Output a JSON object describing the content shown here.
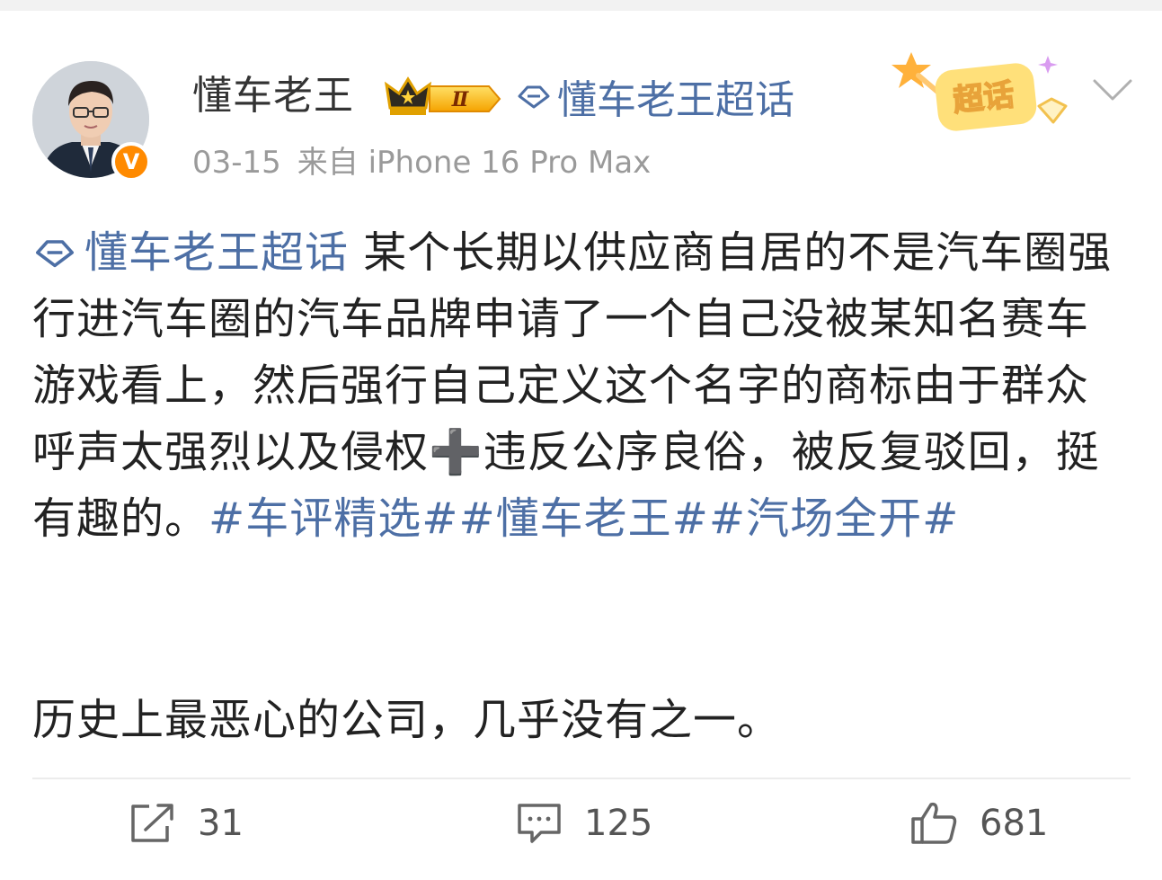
{
  "post": {
    "author": {
      "name": "懂车老王",
      "verified_badge": "V",
      "level_badge": "Ⅱ",
      "topic_tag": "懂车老王超话"
    },
    "meta": {
      "date": "03-15",
      "source": "来自 iPhone 16 Pro Max"
    },
    "chaohua_label": "超话",
    "body": {
      "topic_link": "懂车老王超话",
      "text_part1": " 某个长期以供应商自居的不是汽车圈强行进汽车圈的汽车品牌申请了一个自己没被某知名赛车游戏看上，然后强行自己定义这个名字的商标由于群众呼声太强烈以及侵权",
      "plus": "➕",
      "text_part2": "违反公序良俗，被反复驳回，挺有趣的。",
      "hashtags": "#车评精选##懂车老王##汽场全开#",
      "paragraph2": "历史上最恶心的公司，几乎没有之一。"
    },
    "actions": {
      "share_count": "31",
      "comment_count": "125",
      "like_count": "681"
    }
  },
  "colors": {
    "link_blue": "#4d6fa5",
    "vip_orange": "#ff8a00",
    "meta_gray": "#9a9a9a",
    "chaohua_yellow": "#ffd766"
  },
  "icons": [
    "avatar",
    "v-verified-icon",
    "crown-level-icon",
    "diamond-topic-icon",
    "chaohua-badge-icon",
    "chevron-down-icon",
    "share-icon",
    "comment-icon",
    "like-icon"
  ]
}
